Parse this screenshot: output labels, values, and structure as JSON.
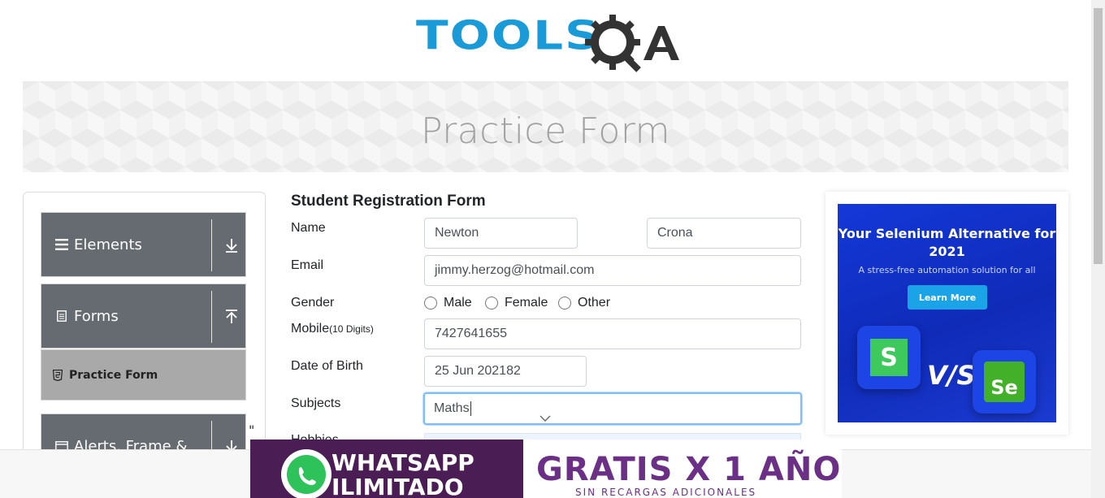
{
  "logo": {
    "text_tools": "TOOLS",
    "text_qa": "QA",
    "colors": {
      "tools": "#1a9ad6",
      "qa": "#333333"
    }
  },
  "banner": {
    "title": "Practice Form"
  },
  "sidebar": {
    "groups": [
      {
        "label": "Elements",
        "icon": "hamburger-icon",
        "arrow": "download-arrow-icon"
      },
      {
        "label": "Forms",
        "icon": "document-icon",
        "arrow": "upload-arrow-icon"
      },
      {
        "label": "Alerts, Frame &",
        "icon": "window-icon",
        "arrow": "download-arrow-icon"
      }
    ],
    "active_item": {
      "label": "Practice Form",
      "icon": "html5-icon"
    },
    "stray": "\""
  },
  "form": {
    "title": "Student Registration Form",
    "labels": {
      "name": "Name",
      "email": "Email",
      "gender": "Gender",
      "mobile": "Mobile",
      "mobile_hint": "(10 Digits)",
      "dob": "Date of Birth",
      "subjects": "Subjects",
      "hobbies": "Hobbies"
    },
    "values": {
      "first_name": "Newton",
      "last_name": "Crona",
      "email": "jimmy.herzog@hotmail.com",
      "mobile": "7427641655",
      "dob": "25 Jun 202182",
      "subjects": "Maths"
    },
    "gender_options": [
      "Male",
      "Female",
      "Other"
    ]
  },
  "side_ad": {
    "title": "Your Selenium Alternative for 2021",
    "subtitle": "A stress-free automation solution for all",
    "button": "Learn More",
    "vs": "V/S",
    "tile_left_letter": "S",
    "tile_right_letter": "Se"
  },
  "bottom_ad": {
    "left_text_1": "WHATSAPP",
    "left_text_2": "ILIMITADO",
    "right_text": "GRATIS X 1 AÑO",
    "right_sub": "SIN RECARGAS ADICIONALES"
  }
}
